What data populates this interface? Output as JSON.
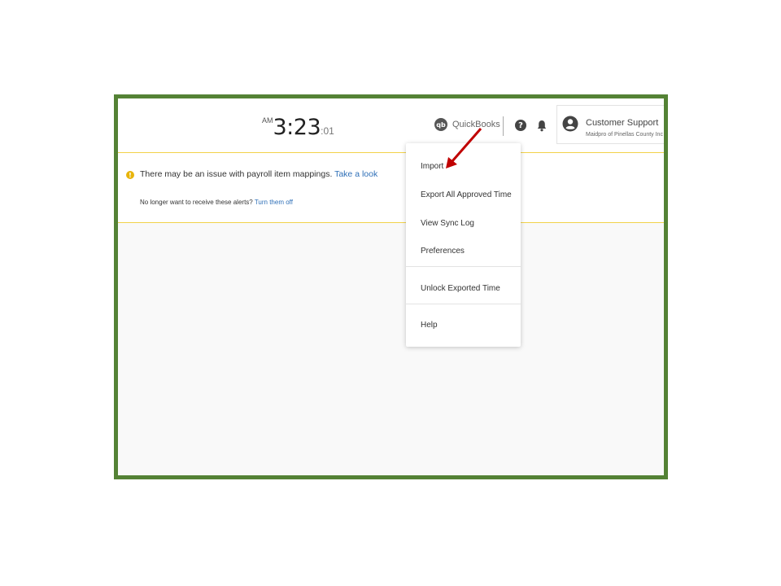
{
  "clock": {
    "ampm": "AM",
    "time": "3:23",
    "seconds": ":01"
  },
  "header": {
    "integration_logo": "qb",
    "integration_label": "QuickBooks",
    "help_icon": "question-circle-icon",
    "notifications_icon": "bell-icon"
  },
  "user": {
    "name": "Customer Support",
    "org": "Maidpro of Pinellas County Inc"
  },
  "alert": {
    "icon_glyph": "!",
    "message": "There may be an issue with payroll item mappings.",
    "message_link": "Take a look",
    "sub_text": "No longer want to receive these alerts?",
    "sub_link": "Turn them off"
  },
  "menu": {
    "items": [
      {
        "label": "Import"
      },
      {
        "label": "Export All Approved Time"
      },
      {
        "label": "View Sync Log"
      },
      {
        "label": "Preferences"
      },
      {
        "label": "Unlock Exported Time"
      },
      {
        "label": "Help"
      }
    ]
  },
  "colors": {
    "frame_border": "#548235",
    "accent_link": "#2e6fb7",
    "alert_border": "#f2d24a",
    "annotation_arrow": "#c00000"
  }
}
